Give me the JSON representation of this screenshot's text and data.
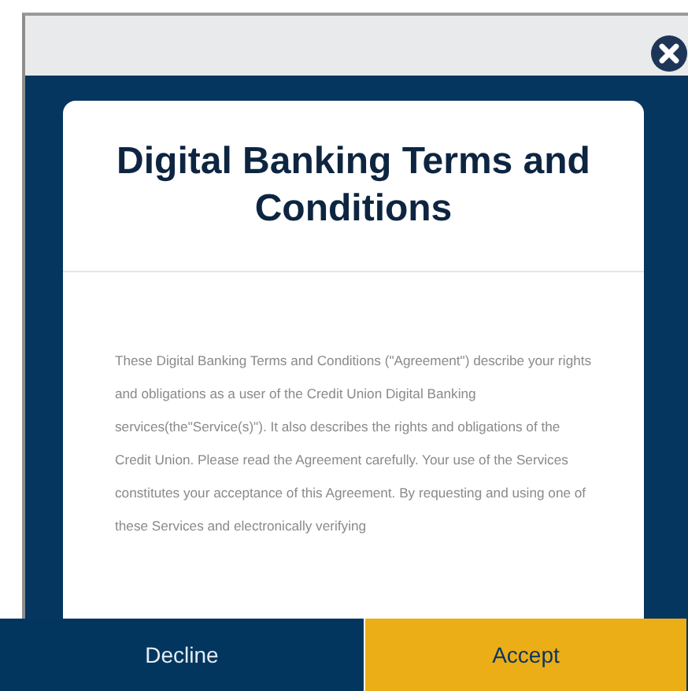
{
  "dialog": {
    "title": "Digital Banking Terms and Conditions",
    "body": "These Digital Banking Terms and Conditions (\"Agreement\") describe your rights and obligations as a user of the Credit Union Digital Banking services(the\"Service(s)\"). It also describes the rights and obligations of the Credit Union. Please read the Agreement carefully. Your use of the Services constitutes your acceptance of this Agreement. By requesting and using one of these Services and electronically verifying"
  },
  "buttons": [
    {
      "label": "Decline",
      "kind": "secondary"
    },
    {
      "label": "Accept",
      "kind": "primary"
    }
  ]
}
